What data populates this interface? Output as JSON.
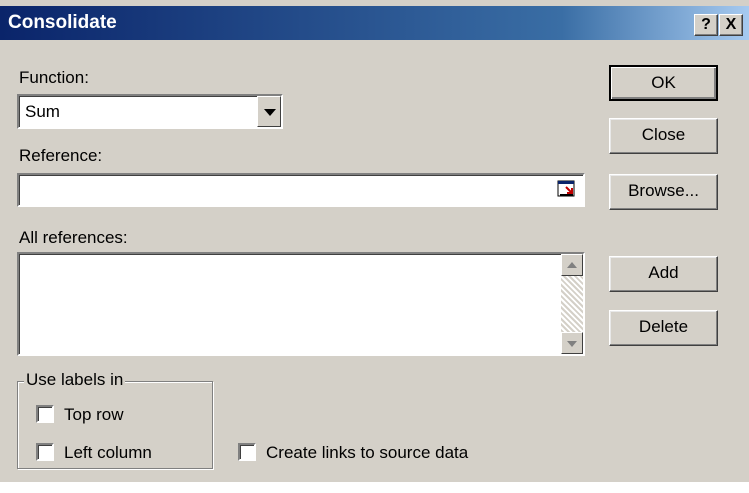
{
  "window": {
    "title": "Consolidate",
    "help_glyph": "?",
    "close_glyph": "X"
  },
  "function": {
    "label": "Function:",
    "selected": "Sum"
  },
  "reference": {
    "label": "Reference:",
    "value": ""
  },
  "all_references": {
    "label": "All references:",
    "items": []
  },
  "buttons": {
    "ok": "OK",
    "close": "Close",
    "browse": "Browse...",
    "add": "Add",
    "delete": "Delete"
  },
  "use_labels": {
    "caption": "Use labels in",
    "top_row": {
      "label": "Top row",
      "checked": false
    },
    "left_column": {
      "label": "Left column",
      "checked": false
    }
  },
  "create_links": {
    "label": "Create links to source data",
    "checked": false
  },
  "icons": [
    "help-icon",
    "close-icon",
    "dropdown-arrow-icon",
    "collapse-dialog-icon",
    "scroll-up-icon",
    "scroll-down-icon"
  ]
}
